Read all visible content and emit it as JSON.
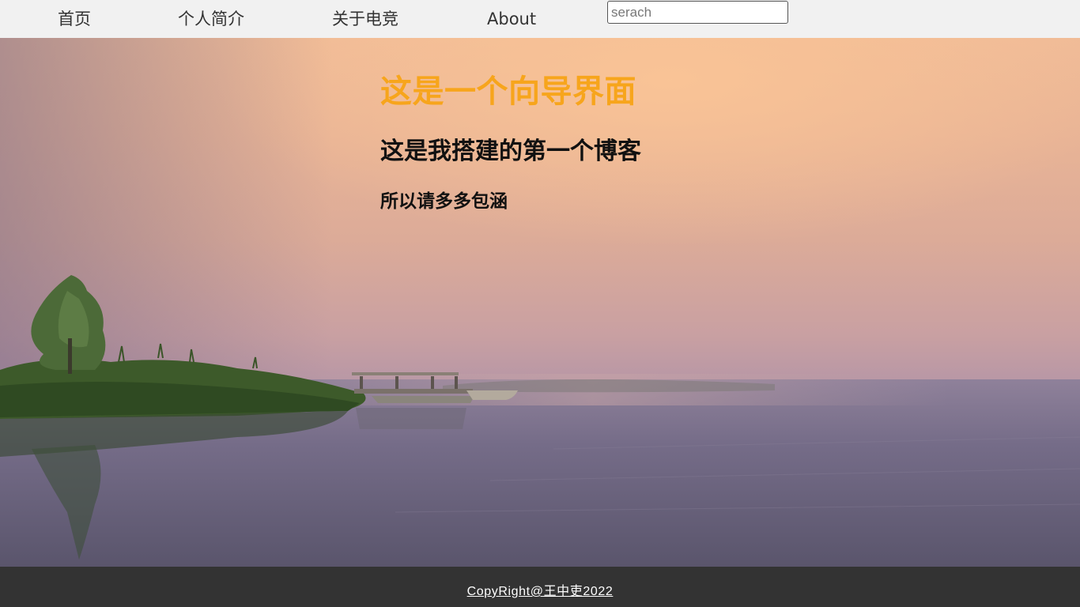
{
  "nav": {
    "items": [
      {
        "label": "首页"
      },
      {
        "label": "个人简介"
      },
      {
        "label": "关于电竞"
      },
      {
        "label": "About"
      }
    ],
    "search": {
      "placeholder": "serach",
      "value": ""
    }
  },
  "hero": {
    "title": "这是一个向导界面",
    "subtitle": "这是我搭建的第一个博客",
    "note": "所以请多多包涵"
  },
  "footer": {
    "copyright": "CopyRight@王中吏2022"
  },
  "colors": {
    "nav_bg": "#f1f1f1",
    "title": "#f7a51c",
    "footer_bg": "#333333"
  }
}
